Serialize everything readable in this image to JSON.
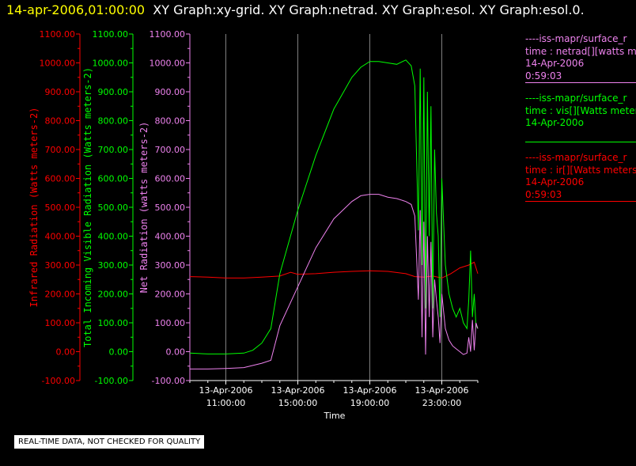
{
  "header": {
    "time": "14-apr-2006,01:00:00",
    "graphs": "XY Graph:xy-grid.  XY Graph:netrad.  XY Graph:esol.  XY Graph:esol.0."
  },
  "colors": {
    "infrared": "#ff0000",
    "visible": "#00ff00",
    "netrad": "#ee82ee",
    "axis": "#ffffff",
    "grid": "#808080"
  },
  "legend": [
    {
      "source": "----iss-mapr/surface_r",
      "var": "time : netrad[][watts me",
      "date": "14-Apr-2006",
      "time": "0:59:03",
      "color": "#ee82ee"
    },
    {
      "source": "----iss-mapr/surface_r",
      "var": "time : vis[][Watts meter",
      "date": "14-Apr-200o",
      "time": "",
      "color": "#00ff00"
    },
    {
      "source": "----iss-mapr/surface_r",
      "var": "time : ir[][Watts meters",
      "date": "14-Apr-2006",
      "time": "0:59:03",
      "color": "#ff0000"
    }
  ],
  "disclaimer": "REAL-TIME DATA, NOT CHECKED FOR QUALITY",
  "chart_data": {
    "type": "line",
    "xlabel": "Time",
    "x_range": [
      "13-Apr-2006 09:00",
      "14-Apr-2006 01:00"
    ],
    "x_ticks": [
      {
        "date": "13-Apr-2006",
        "time": "11:00:00",
        "hour": 11
      },
      {
        "date": "13-Apr-2006",
        "time": "15:00:00",
        "hour": 15
      },
      {
        "date": "13-Apr-2006",
        "time": "19:00:00",
        "hour": 19
      },
      {
        "date": "13-Apr-2006",
        "time": "23:00:00",
        "hour": 23
      }
    ],
    "grid": "vertical",
    "axes": [
      {
        "id": "infrared",
        "label": "Infrared Radiation (Watts meters-2)",
        "color": "#ff0000",
        "ylim": [
          -100,
          1100
        ],
        "ticks": [
          "-100.00",
          "0.00",
          "100.00",
          "200.00",
          "300.00",
          "400.00",
          "500.00",
          "600.00",
          "700.00",
          "800.00",
          "900.00",
          "1000.00",
          "1100.00"
        ]
      },
      {
        "id": "visible",
        "label": "Total Incoming Visible Radiation (Watts meters-2)",
        "color": "#00ff00",
        "ylim": [
          -100,
          1100
        ],
        "ticks": [
          "-100.00",
          "0.00",
          "100.00",
          "200.00",
          "300.00",
          "400.00",
          "500.00",
          "600.00",
          "700.00",
          "800.00",
          "900.00",
          "1000.00",
          "1100.00"
        ]
      },
      {
        "id": "netrad",
        "label": "Net Radiation (watts meters-2)",
        "color": "#ee82ee",
        "ylim": [
          -100,
          1100
        ],
        "ticks": [
          "-100.00",
          "0.00",
          "100.00",
          "200.00",
          "300.00",
          "400.00",
          "500.00",
          "600.00",
          "700.00",
          "800.00",
          "900.00",
          "1000.00",
          "1100.00"
        ]
      }
    ],
    "series": [
      {
        "axis": "infrared",
        "color": "#ff0000",
        "x": [
          9.0,
          10.0,
          11.0,
          12.0,
          13.0,
          14.0,
          14.6,
          15.0,
          16.0,
          17.0,
          18.0,
          19.0,
          20.0,
          21.0,
          21.5,
          22.0,
          22.5,
          23.0,
          23.5,
          24.0,
          24.5,
          24.8,
          25.0
        ],
        "y": [
          260,
          258,
          255,
          255,
          258,
          262,
          275,
          268,
          270,
          275,
          278,
          280,
          278,
          270,
          260,
          258,
          262,
          255,
          270,
          290,
          300,
          310,
          270
        ]
      },
      {
        "axis": "visible",
        "color": "#00ff00",
        "x": [
          9.0,
          10.0,
          11.0,
          12.0,
          12.5,
          13.0,
          13.5,
          14.0,
          15.0,
          16.0,
          17.0,
          18.0,
          18.5,
          19.0,
          19.5,
          20.0,
          20.5,
          21.0,
          21.3,
          21.5,
          21.7,
          21.8,
          21.9,
          22.0,
          22.1,
          22.2,
          22.3,
          22.4,
          22.5,
          22.6,
          22.7,
          22.8,
          22.9,
          23.0,
          23.2,
          23.4,
          23.6,
          23.8,
          24.0,
          24.2,
          24.4,
          24.5,
          24.6,
          24.7,
          24.8,
          24.9,
          25.0
        ],
        "y": [
          -5,
          -8,
          -8,
          -5,
          5,
          30,
          80,
          270,
          490,
          680,
          840,
          950,
          985,
          1005,
          1005,
          1000,
          995,
          1010,
          990,
          920,
          420,
          980,
          300,
          950,
          150,
          900,
          400,
          850,
          150,
          700,
          480,
          400,
          120,
          600,
          300,
          200,
          150,
          120,
          150,
          100,
          80,
          180,
          350,
          120,
          200,
          90,
          80
        ]
      },
      {
        "axis": "netrad",
        "color": "#ee82ee",
        "x": [
          9.0,
          10.0,
          11.0,
          12.0,
          13.0,
          13.5,
          14.0,
          15.0,
          16.0,
          17.0,
          18.0,
          18.5,
          19.0,
          19.5,
          20.0,
          20.5,
          21.0,
          21.3,
          21.5,
          21.7,
          21.8,
          21.9,
          22.0,
          22.1,
          22.2,
          22.3,
          22.4,
          22.5,
          22.6,
          22.7,
          22.8,
          22.9,
          23.0,
          23.2,
          23.4,
          23.6,
          23.8,
          24.0,
          24.2,
          24.4,
          24.5,
          24.6,
          24.7,
          24.8,
          24.9,
          25.0
        ],
        "y": [
          -60,
          -60,
          -58,
          -55,
          -40,
          -30,
          90,
          225,
          360,
          460,
          520,
          540,
          545,
          545,
          535,
          530,
          520,
          510,
          470,
          180,
          490,
          50,
          450,
          -10,
          400,
          120,
          380,
          50,
          250,
          180,
          120,
          30,
          200,
          80,
          40,
          20,
          10,
          0,
          -10,
          -5,
          50,
          0,
          110,
          5,
          100,
          80
        ]
      }
    ]
  }
}
